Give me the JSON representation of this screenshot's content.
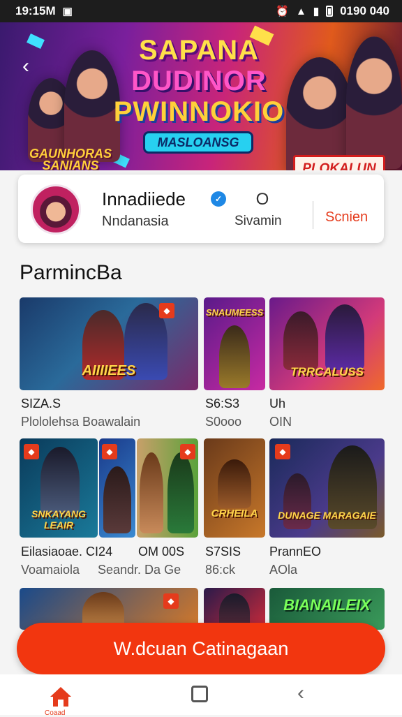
{
  "status_bar": {
    "time": "19:15M",
    "right_text": "0190 040"
  },
  "banner": {
    "title_line1": "SAPANA",
    "title_line2": "DUDINOR",
    "title_line3": "PWINNOKIO",
    "subtitle": "MASLOANSG",
    "left_text": "GAUNHORAS SANIANS",
    "cta_label": "PLOKALUN"
  },
  "profile": {
    "name": "Innadiiede",
    "subtitle": "Nndanasia",
    "stat_value": "O",
    "stat_label": "Sivamin",
    "follow_label": "Scnien"
  },
  "section_title": "ParmincBa",
  "games_row1": [
    {
      "art_label": "AIIIIEES",
      "title": "SIZA.S",
      "subtitle": "Plololehsa  Boawalain"
    },
    {
      "art_label": "SNAUMEESS",
      "title": "S6:S3",
      "subtitle": "S0ooo"
    },
    {
      "art_label": "TRRCALUSS",
      "title": "Uh",
      "subtitle": "OIN"
    }
  ],
  "games_row2": [
    {
      "art_label": "SNKAYANG LEAIR",
      "title": "Eilasiaoae. CI24",
      "subtitle": "Voamaiola"
    },
    {
      "art_label": "",
      "title": "OM 00S",
      "subtitle": "Seandr. Da Ge"
    },
    {
      "art_label": "CRHEILA",
      "title": "S7SIS",
      "subtitle": "86:ck"
    },
    {
      "art_label": "DUNAGE MARAGAIE",
      "title": "PrannEO",
      "subtitle": "AOla"
    }
  ],
  "games_row3": [
    {
      "art_label": ""
    },
    {
      "art_label": ""
    },
    {
      "art_label": "BIANAILEIX"
    }
  ],
  "cta_button": "W.dcuan Catinagaan",
  "nav": {
    "home_label": "Coaad"
  }
}
